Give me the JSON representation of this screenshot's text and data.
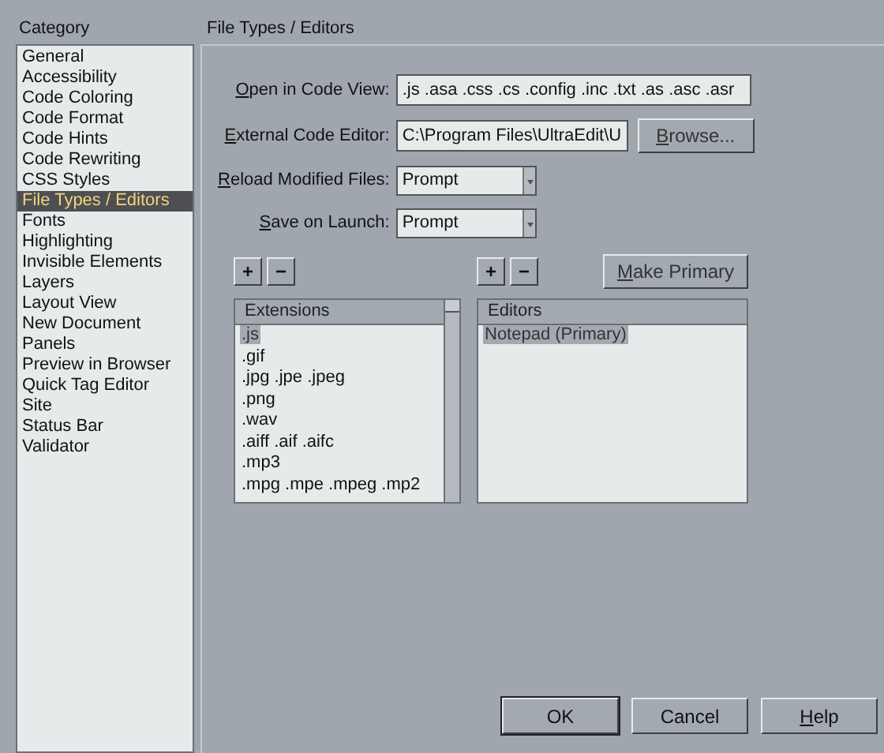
{
  "category": {
    "title": "Category",
    "items": [
      {
        "label": "General",
        "selected": false
      },
      {
        "label": "Accessibility",
        "selected": false
      },
      {
        "label": "Code Coloring",
        "selected": false
      },
      {
        "label": "Code Format",
        "selected": false
      },
      {
        "label": "Code Hints",
        "selected": false
      },
      {
        "label": "Code Rewriting",
        "selected": false
      },
      {
        "label": "CSS Styles",
        "selected": false
      },
      {
        "label": "File Types / Editors",
        "selected": true
      },
      {
        "label": "Fonts",
        "selected": false
      },
      {
        "label": "Highlighting",
        "selected": false
      },
      {
        "label": "Invisible Elements",
        "selected": false
      },
      {
        "label": "Layers",
        "selected": false
      },
      {
        "label": "Layout View",
        "selected": false
      },
      {
        "label": "New Document",
        "selected": false
      },
      {
        "label": "Panels",
        "selected": false
      },
      {
        "label": "Preview in Browser",
        "selected": false
      },
      {
        "label": "Quick Tag Editor",
        "selected": false
      },
      {
        "label": "Site",
        "selected": false
      },
      {
        "label": "Status Bar",
        "selected": false
      },
      {
        "label": "Validator",
        "selected": false
      }
    ]
  },
  "panel": {
    "title": "File Types / Editors",
    "fields": [
      {
        "kind": "text",
        "accel": "O",
        "label": "pen in Code View:",
        "value": ".js .asa .css .cs .config .inc .txt .as .asc .asr"
      },
      {
        "kind": "path",
        "accel": "E",
        "label": "xternal Code Editor:",
        "value": "C:\\Program Files\\UltraEdit\\U",
        "button": {
          "accel": "B",
          "label": "rowse..."
        }
      },
      {
        "kind": "select",
        "accel": "R",
        "label": "eload Modified Files:",
        "value": "Prompt"
      },
      {
        "kind": "select",
        "accel": "S",
        "label": "ave on Launch:",
        "value": "Prompt"
      }
    ],
    "extensions": {
      "add": "+",
      "remove": "−",
      "header": "Extensions",
      "items": [
        {
          "label": ".js",
          "selected": true
        },
        {
          "label": ".gif",
          "selected": false
        },
        {
          "label": ".jpg .jpe .jpeg",
          "selected": false
        },
        {
          "label": ".png",
          "selected": false
        },
        {
          "label": ".wav",
          "selected": false
        },
        {
          "label": ".aiff .aif .aifc",
          "selected": false
        },
        {
          "label": ".mp3",
          "selected": false
        },
        {
          "label": ".mpg .mpe .mpeg .mp2",
          "selected": false
        }
      ]
    },
    "editors": {
      "add": "+",
      "remove": "−",
      "make_primary": {
        "accel": "M",
        "label": "ake Primary"
      },
      "header": "Editors",
      "items": [
        {
          "label": "Notepad (Primary)",
          "selected": true
        }
      ]
    }
  },
  "buttons": [
    {
      "label": "OK",
      "default": true
    },
    {
      "label": "Cancel",
      "default": false
    },
    {
      "accel": "H",
      "label": "elp",
      "default": false
    }
  ]
}
